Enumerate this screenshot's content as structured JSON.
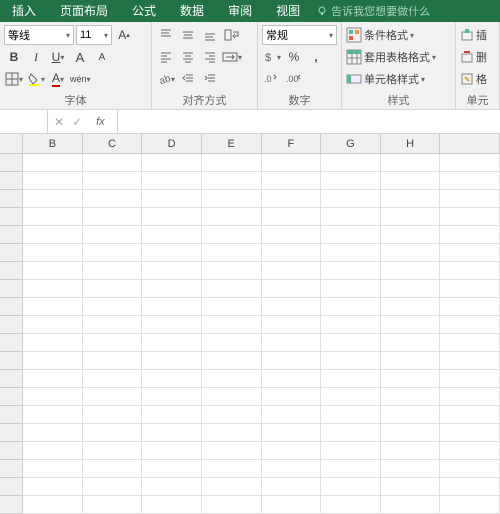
{
  "tabs": {
    "insert": "插入",
    "layout": "页面布局",
    "formula": "公式",
    "data": "数据",
    "review": "审阅",
    "view": "视图",
    "tell": "告诉我您想要做什么"
  },
  "font": {
    "name": "等线",
    "size": "11",
    "label": "字体"
  },
  "align": {
    "label": "对齐方式"
  },
  "number": {
    "format": "常规",
    "label": "数字"
  },
  "styles": {
    "cond": "条件格式",
    "table": "套用表格格式",
    "cell": "单元格样式",
    "label": "样式"
  },
  "cells": {
    "insert": "插",
    "delete": "删",
    "format": "格",
    "label": "单元"
  },
  "cols": [
    "B",
    "C",
    "D",
    "E",
    "F",
    "G",
    "H"
  ],
  "fx": "fx"
}
